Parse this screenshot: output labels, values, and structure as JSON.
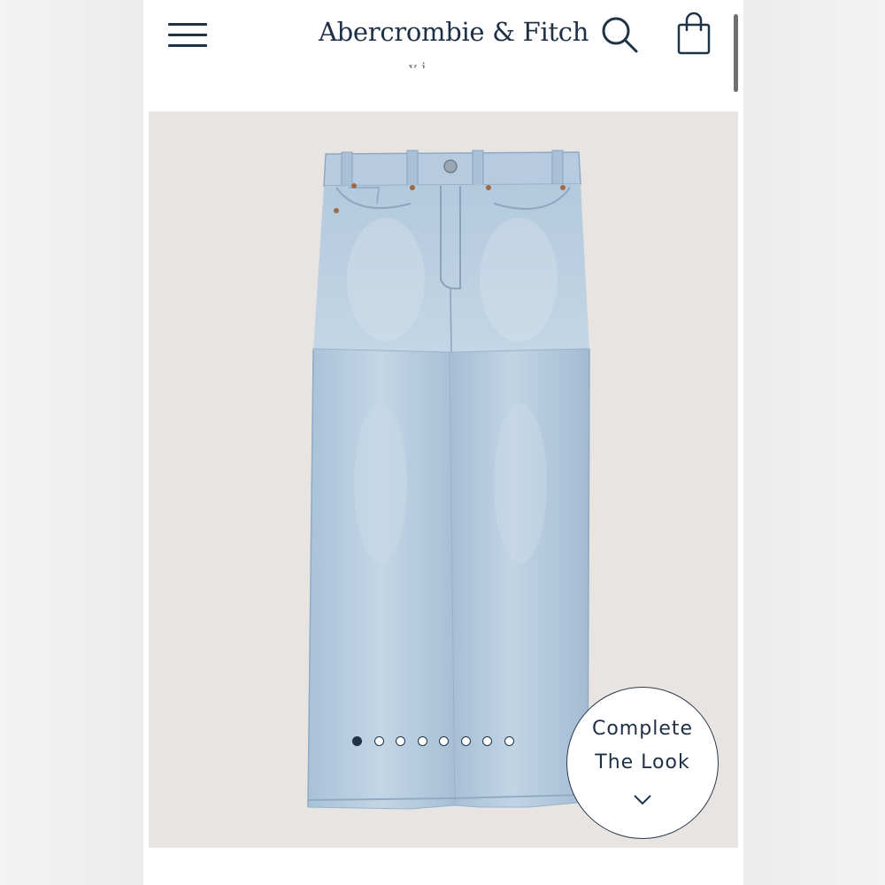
{
  "header": {
    "brand": "Abercrombie & Fitch",
    "peek_text": "y j..."
  },
  "carousel": {
    "total_slides": 8,
    "active_index": 0
  },
  "complete_the_look": {
    "line1": "Complete",
    "line2": "The Look"
  },
  "colors": {
    "brand_navy": "#1f3347",
    "image_background": "#e8e4e1",
    "denim_light": "#b9cfe0",
    "denim_shadow": "#9fb8cf"
  },
  "icons": [
    "menu-icon",
    "search-icon",
    "shopping-bag-icon",
    "chevron-down-icon"
  ]
}
